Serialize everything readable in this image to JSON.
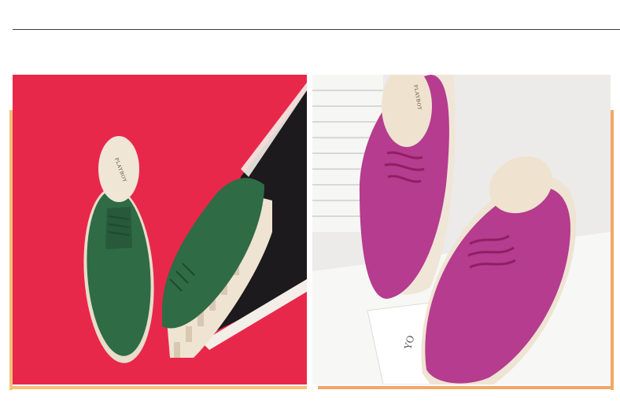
{
  "colors": {
    "rule": "#3a3a3a",
    "accent_left": "#f5c27a",
    "accent_right": "#f2a766",
    "backdrop_red": "#e8284a",
    "backdrop_black": "#1c1a1d",
    "shoe_green": "#2f6b45",
    "shoe_magenta": "#b53c8e"
  },
  "product_photos": [
    {
      "subject": "green suede lace-up oxford shoes",
      "brand_text": "PLAYBOY"
    },
    {
      "subject": "magenta suede lace-up oxford shoes",
      "brand_text": "PLAYBOY",
      "background_text": "YO"
    }
  ]
}
